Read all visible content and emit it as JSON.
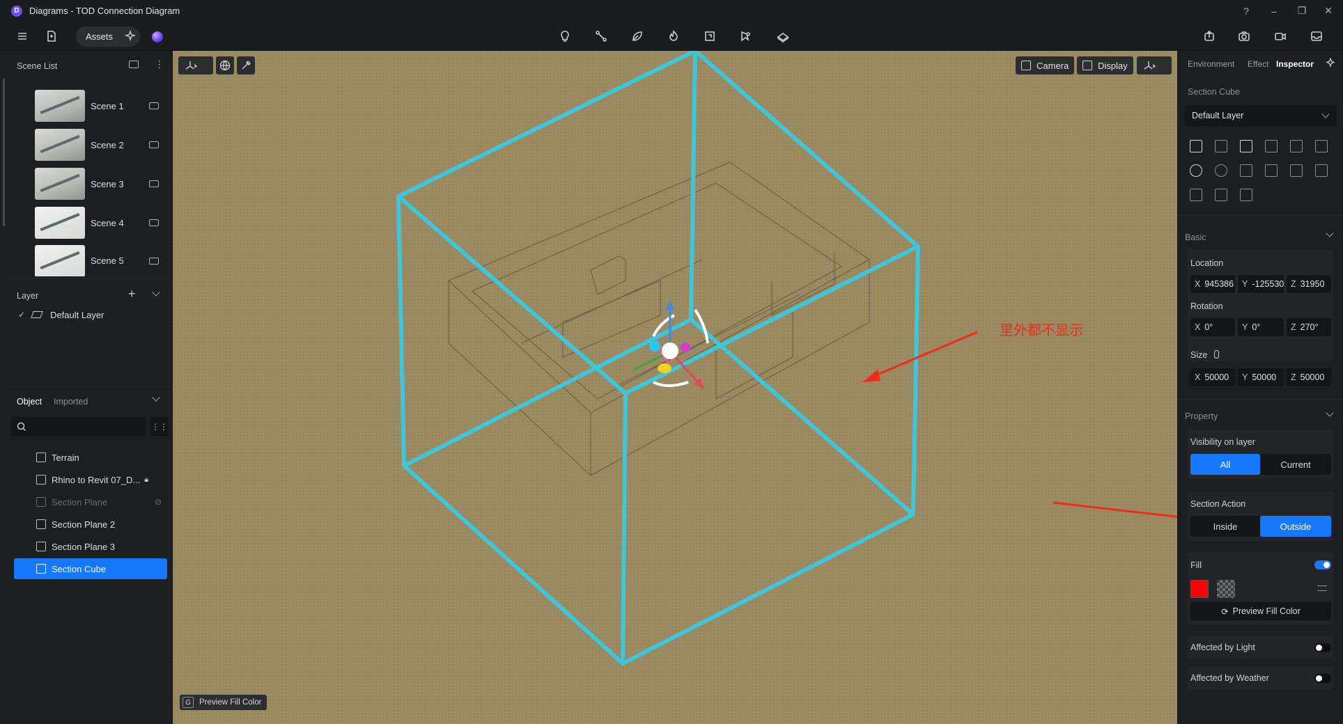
{
  "window": {
    "logo": "D",
    "title": "Diagrams - TOD Connection Diagram",
    "controls": [
      "?",
      "–",
      "❐",
      "✕"
    ]
  },
  "toolbar": {
    "assets_label": "Assets",
    "center_icons": [
      "light-bulb-icon",
      "path-icon",
      "leaf-icon",
      "fire-icon",
      "section-icon",
      "marker-icon",
      "terrain-icon"
    ],
    "right_icons": [
      "export-icon",
      "camera-snapshot-icon",
      "video-icon",
      "inbox-icon"
    ]
  },
  "left": {
    "scene_list_title": "Scene List",
    "scenes": [
      {
        "label": "Scene 1"
      },
      {
        "label": "Scene 2"
      },
      {
        "label": "Scene 3"
      },
      {
        "label": "Scene 4"
      },
      {
        "label": "Scene 5"
      }
    ],
    "layer_title": "Layer",
    "layer_item": "Default Layer",
    "object_tab": "Object",
    "imported_tab": "Imported",
    "search_placeholder": "",
    "objects": [
      {
        "label": "Terrain",
        "state": "normal"
      },
      {
        "label": "Rhino to Revit 07_D...",
        "state": "locked"
      },
      {
        "label": "Section Plane",
        "state": "hidden"
      },
      {
        "label": "Section Plane 2",
        "state": "normal"
      },
      {
        "label": "Section Plane 3",
        "state": "normal"
      },
      {
        "label": "Section Cube",
        "state": "selected"
      }
    ]
  },
  "viewport": {
    "camera_label": "Camera",
    "display_label": "Display",
    "bottom_key": "G",
    "bottom_label": "Preview Fill Color",
    "annotation": "里外都不显示",
    "cube_color": "#3fc6d8",
    "ground_color": "#9b8a62"
  },
  "right": {
    "tabs": [
      "Environment",
      "Effect",
      "Inspector"
    ],
    "active_tab": "Inspector",
    "object_name": "Section Cube",
    "layer_select": "Default Layer",
    "basic_title": "Basic",
    "location_label": "Location",
    "location": {
      "x": "945386",
      "y": "-125530",
      "z": "31950"
    },
    "rotation_label": "Rotation",
    "rotation": {
      "x": "0°",
      "y": "0°",
      "z": "270°"
    },
    "size_label": "Size",
    "size": {
      "x": "50000",
      "y": "50000",
      "z": "50000"
    },
    "axis": {
      "x": "X",
      "y": "Y",
      "z": "Z"
    },
    "property_title": "Property",
    "visibility_label": "Visibility on layer",
    "visibility_all": "All",
    "visibility_current": "Current",
    "section_action_label": "Section Action",
    "inside_label": "Inside",
    "outside_label": "Outside",
    "fill_label": "Fill",
    "fill_color": "#ff0000",
    "preview_fill_label": "Preview Fill Color",
    "affected_light_label": "Affected by Light",
    "affected_weather_label": "Affected by Weather",
    "accent": "#1677ff"
  }
}
